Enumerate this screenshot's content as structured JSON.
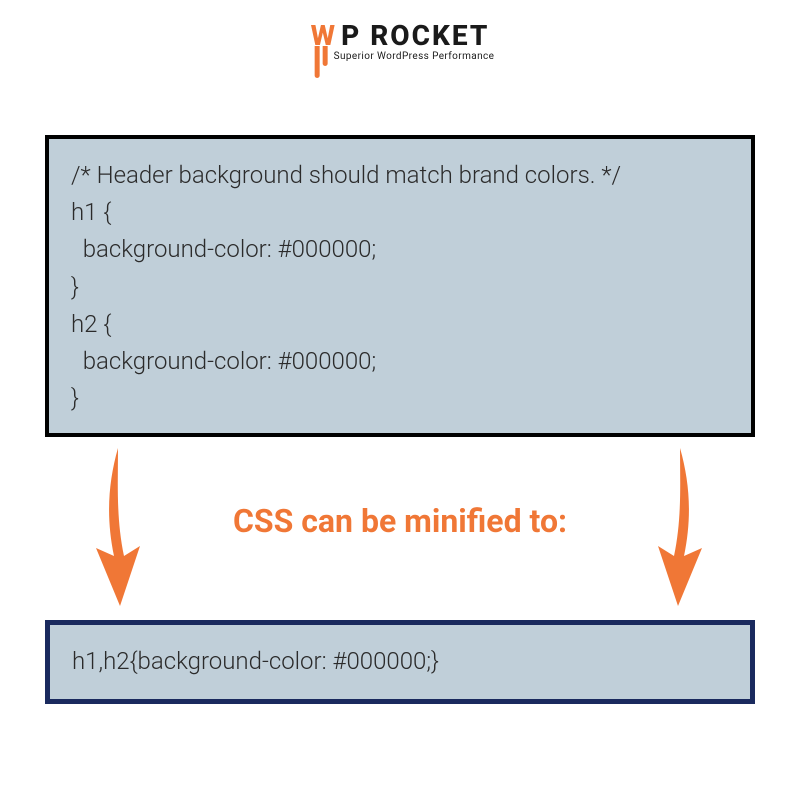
{
  "brand": {
    "prefix": "W",
    "name": "P ROCKET",
    "tagline": "Superior WordPress Performance",
    "accent": "#f07736",
    "dark": "#1a1a1a"
  },
  "source_code": "/* Header background should match brand colors. */\nh1 {\n  background-color: #000000;\n}\nh2 {\n  background-color: #000000;\n}",
  "caption": "CSS can be minified to:",
  "result_code": "h1,h2{background-color: #000000;}",
  "colors": {
    "panel": "#c0cfd9",
    "border_top": "#000000",
    "border_bottom": "#1a2a5e",
    "arrow": "#f07736"
  }
}
